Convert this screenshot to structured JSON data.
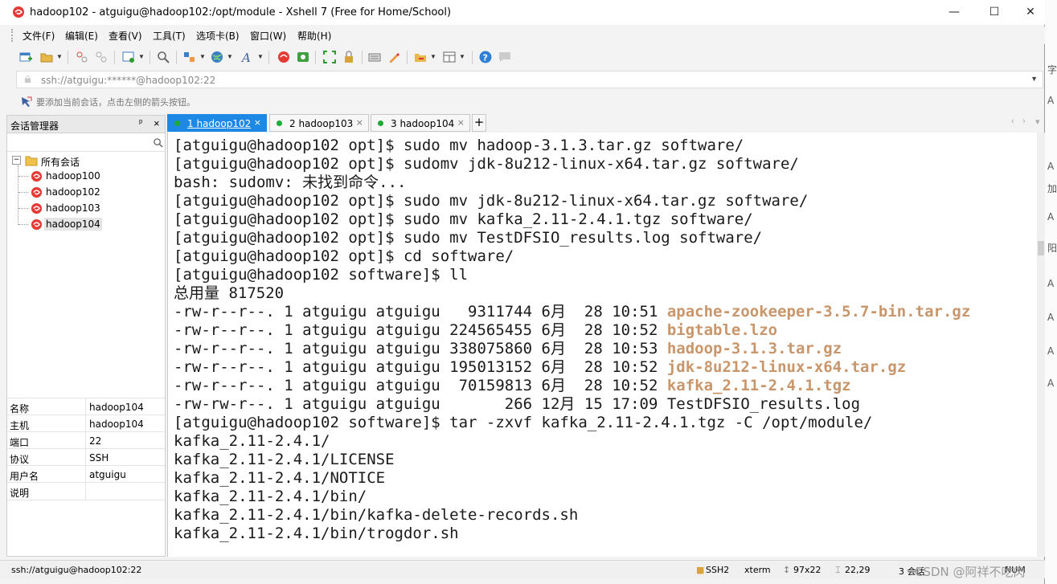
{
  "window": {
    "title": "hadoop102 - atguigu@hadoop102:/opt/module - Xshell 7 (Free for Home/School)",
    "minimize": "—",
    "maximize": "☐",
    "close": "✕"
  },
  "menu": [
    "文件(F)",
    "编辑(E)",
    "查看(V)",
    "工具(T)",
    "选项卡(B)",
    "窗口(W)",
    "帮助(H)"
  ],
  "address": {
    "value": "ssh://atguigu:******@hadoop102:22"
  },
  "hint": "要添加当前会话，点击左侧的箭头按钮。",
  "sidebar": {
    "title": "会话管理器",
    "pin": "ᵖ",
    "close": "×",
    "tree_root": "所有会话",
    "sessions": [
      "hadoop100",
      "hadoop102",
      "hadoop103",
      "hadoop104"
    ],
    "selected": "hadoop104"
  },
  "properties": [
    {
      "key": "名称",
      "value": "hadoop104"
    },
    {
      "key": "主机",
      "value": "hadoop104"
    },
    {
      "key": "端口",
      "value": "22"
    },
    {
      "key": "协议",
      "value": "SSH"
    },
    {
      "key": "用户名",
      "value": "atguigu"
    },
    {
      "key": "说明",
      "value": ""
    }
  ],
  "tabs": [
    {
      "label": "1 hadoop102",
      "active": true
    },
    {
      "label": "2 hadoop103",
      "active": false
    },
    {
      "label": "3 hadoop104",
      "active": false
    }
  ],
  "tab_add": "+",
  "tab_close": "×",
  "terminal": [
    "[atguigu@hadoop102 opt]$ sudo mv hadoop-3.1.3.tar.gz software/",
    "[atguigu@hadoop102 opt]$ sudomv jdk-8u212-linux-x64.tar.gz software/",
    "bash: sudomv: 未找到命令...",
    "[atguigu@hadoop102 opt]$ sudo mv jdk-8u212-linux-x64.tar.gz software/",
    "[atguigu@hadoop102 opt]$ sudo mv kafka_2.11-2.4.1.tgz software/",
    "[atguigu@hadoop102 opt]$ sudo mv TestDFSIO_results.log software/",
    "[atguigu@hadoop102 opt]$ cd software/",
    "[atguigu@hadoop102 software]$ ll",
    "总用量 817520",
    {
      "prefix": "-rw-r--r--. 1 atguigu atguigu   9311744 6月  28 10:51 ",
      "file": "apache-zookeeper-3.5.7-bin.tar.gz"
    },
    {
      "prefix": "-rw-r--r--. 1 atguigu atguigu 224565455 6月  28 10:52 ",
      "file": "bigtable.lzo"
    },
    {
      "prefix": "-rw-r--r--. 1 atguigu atguigu 338075860 6月  28 10:53 ",
      "file": "hadoop-3.1.3.tar.gz"
    },
    {
      "prefix": "-rw-r--r--. 1 atguigu atguigu 195013152 6月  28 10:52 ",
      "file": "jdk-8u212-linux-x64.tar.gz"
    },
    {
      "prefix": "-rw-r--r--. 1 atguigu atguigu  70159813 6月  28 10:52 ",
      "file": "kafka_2.11-2.4.1.tgz"
    },
    "-rw-rw-r--. 1 atguigu atguigu       266 12月 15 17:09 TestDFSIO_results.log",
    "[atguigu@hadoop102 software]$ tar -zxvf kafka_2.11-2.4.1.tgz -C /opt/module/",
    "kafka_2.11-2.4.1/",
    "kafka_2.11-2.4.1/LICENSE",
    "kafka_2.11-2.4.1/NOTICE",
    "kafka_2.11-2.4.1/bin/",
    "kafka_2.11-2.4.1/bin/kafka-delete-records.sh",
    "kafka_2.11-2.4.1/bin/trogdor.sh"
  ],
  "status": {
    "connection": "ssh://atguigu@hadoop102:22",
    "protocol": "SSH2",
    "term": "xterm",
    "size": "97x22",
    "cursor": "22,29",
    "sessions": "3 会话",
    "caps": "NUM",
    "watermark": "CSDN @阿祥不吃肉"
  },
  "right_strip": [
    "字",
    "A",
    "A",
    "加",
    "A",
    "阳",
    "A",
    "A",
    "A",
    "A"
  ],
  "colors": {
    "tab_active": "#1e88e5",
    "file_highlight": "#c8966a",
    "status_green": "#1faa36"
  }
}
